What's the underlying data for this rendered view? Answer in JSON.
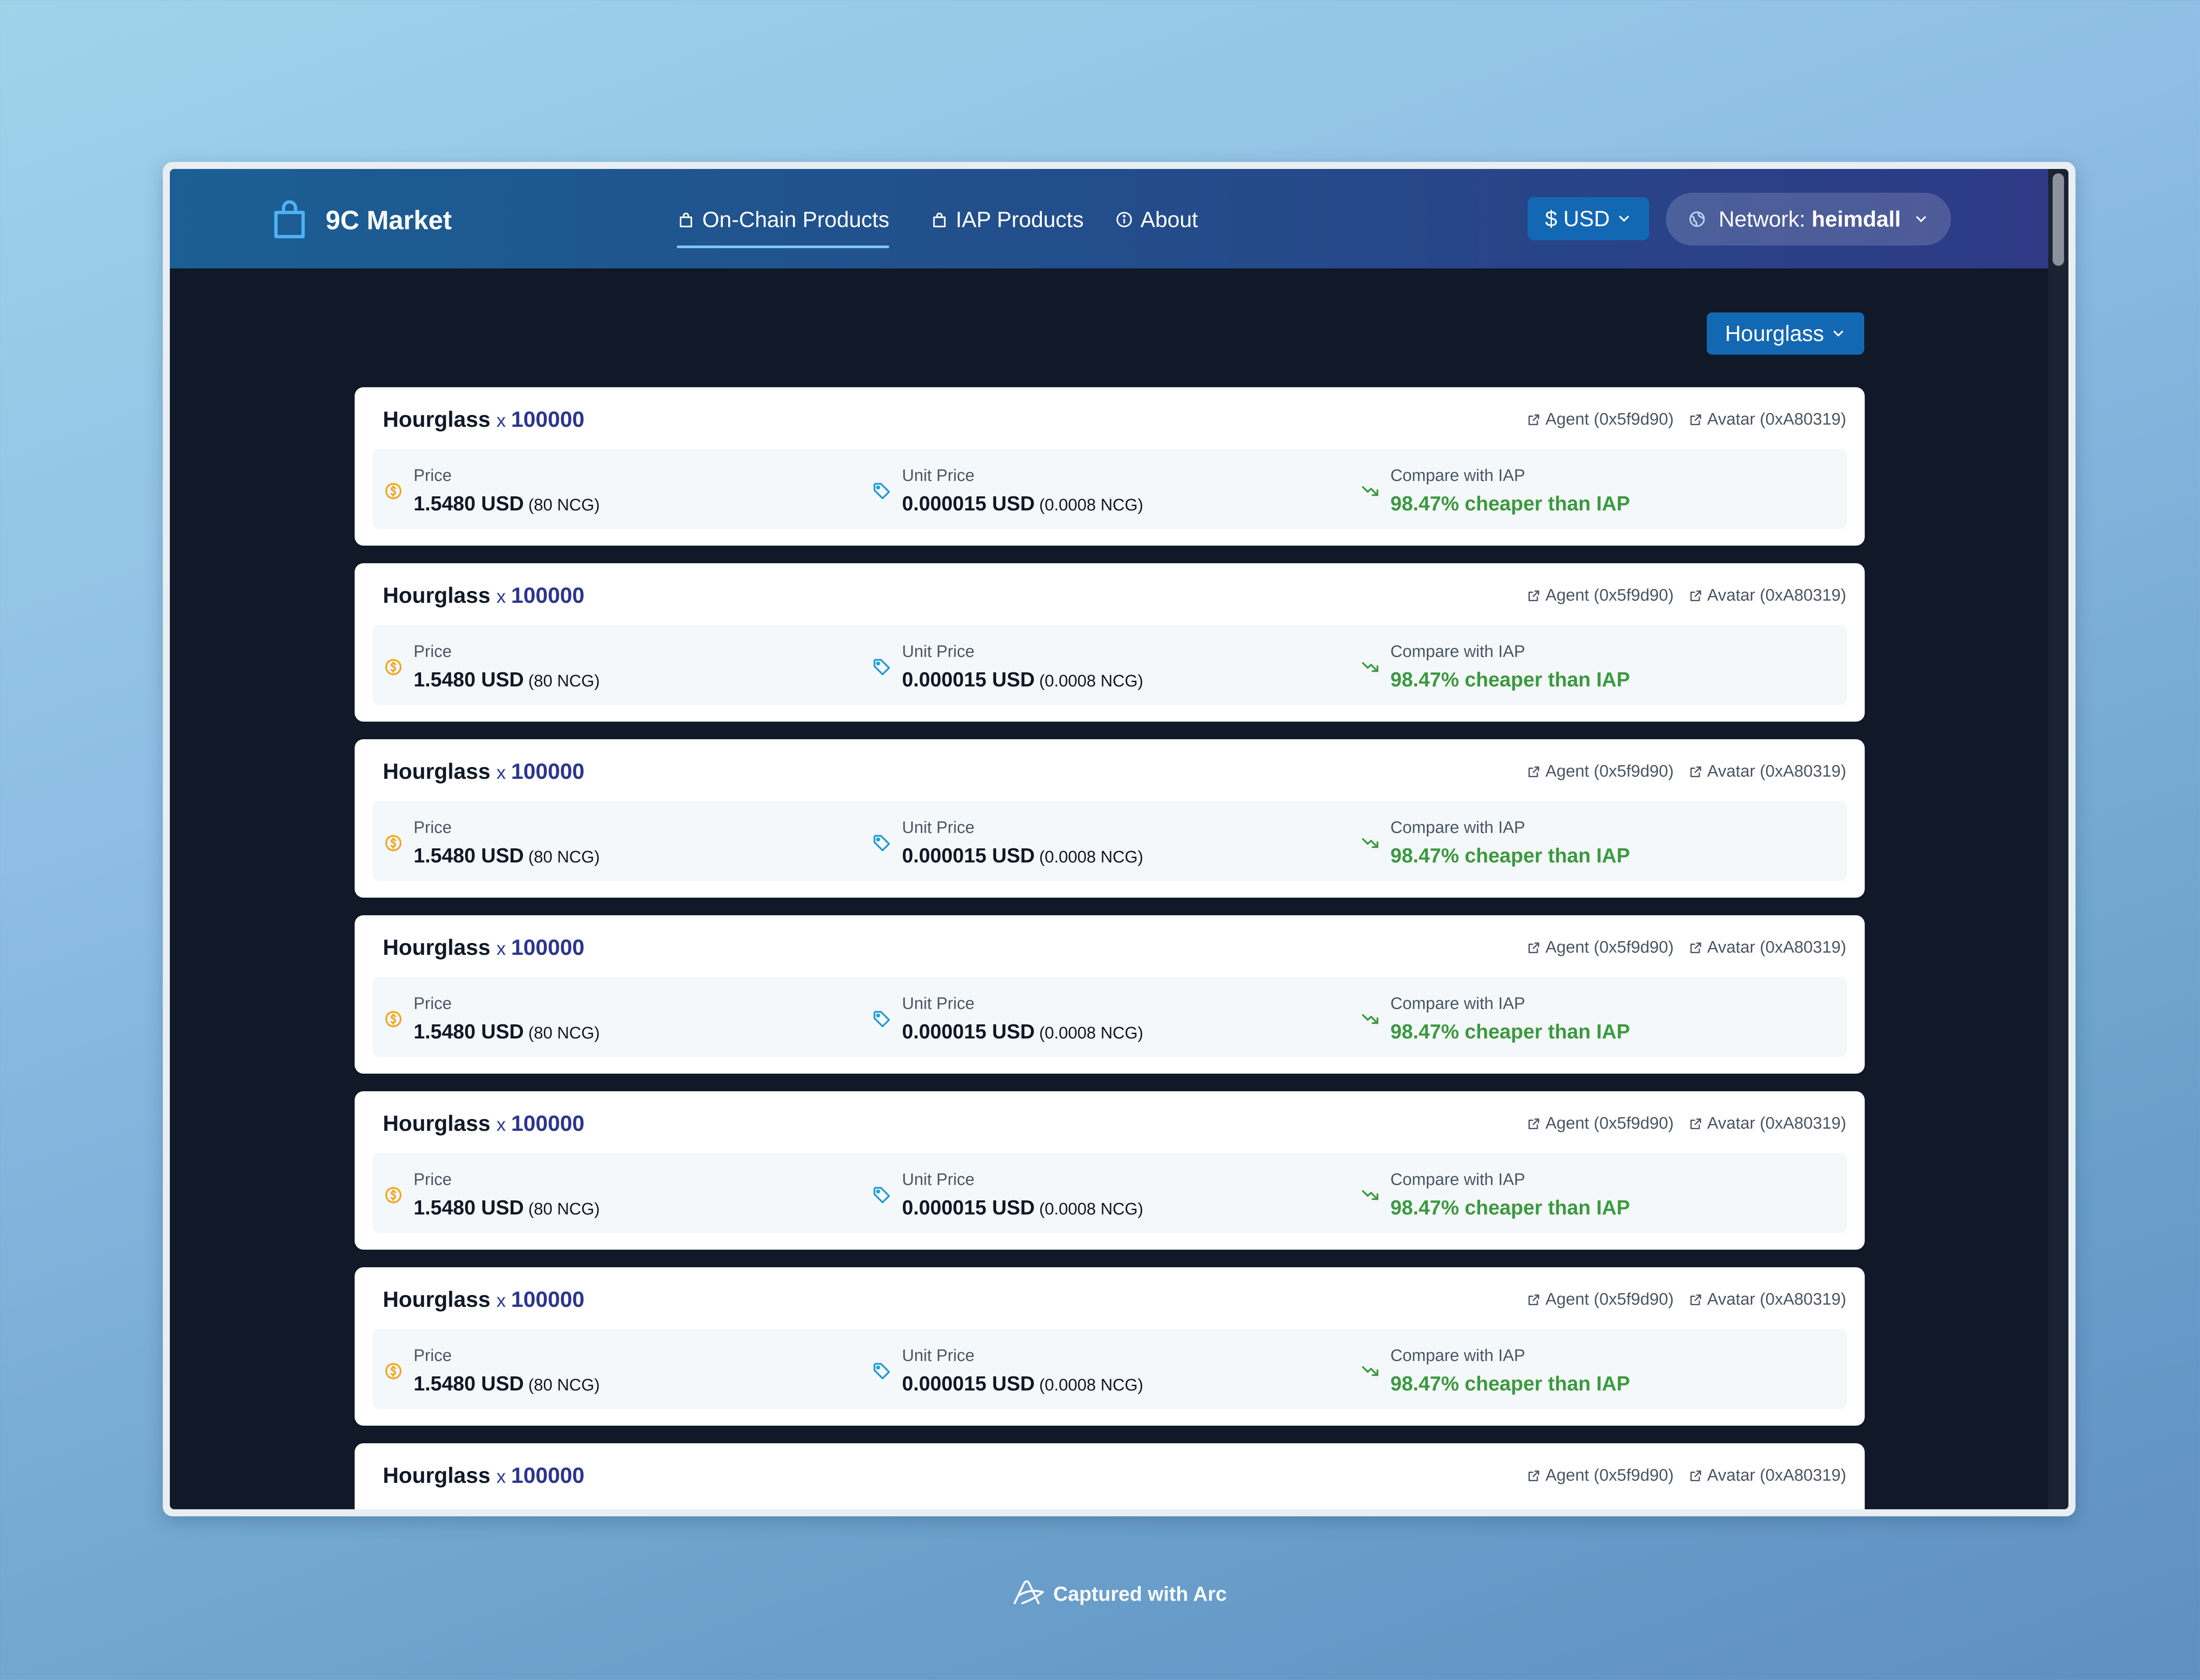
{
  "app": {
    "name": "9C Market"
  },
  "nav": {
    "links": [
      {
        "label": "On-Chain Products",
        "icon": "bag-icon",
        "active": true
      },
      {
        "label": "IAP Products",
        "icon": "bag-icon",
        "active": false
      },
      {
        "label": "About",
        "icon": "info-icon",
        "active": false
      }
    ]
  },
  "currency": {
    "label": "$ USD"
  },
  "network": {
    "prefix": "Network:",
    "value": "heimdall"
  },
  "filter": {
    "selected": "Hourglass"
  },
  "labels": {
    "price": "Price",
    "unit_price": "Unit Price",
    "compare": "Compare with IAP"
  },
  "products": [
    {
      "name": "Hourglass",
      "times": "x",
      "quantity": "100000",
      "agent": "Agent (0x5f9d90)",
      "avatar": "Avatar (0xA80319)",
      "price": "1.5480 USD",
      "price_ncg": "(80 NCG)",
      "unit_price": "0.000015 USD",
      "unit_price_ncg": "(0.0008 NCG)",
      "compare": "98.47% cheaper than IAP"
    },
    {
      "name": "Hourglass",
      "times": "x",
      "quantity": "100000",
      "agent": "Agent (0x5f9d90)",
      "avatar": "Avatar (0xA80319)",
      "price": "1.5480 USD",
      "price_ncg": "(80 NCG)",
      "unit_price": "0.000015 USD",
      "unit_price_ncg": "(0.0008 NCG)",
      "compare": "98.47% cheaper than IAP"
    },
    {
      "name": "Hourglass",
      "times": "x",
      "quantity": "100000",
      "agent": "Agent (0x5f9d90)",
      "avatar": "Avatar (0xA80319)",
      "price": "1.5480 USD",
      "price_ncg": "(80 NCG)",
      "unit_price": "0.000015 USD",
      "unit_price_ncg": "(0.0008 NCG)",
      "compare": "98.47% cheaper than IAP"
    },
    {
      "name": "Hourglass",
      "times": "x",
      "quantity": "100000",
      "agent": "Agent (0x5f9d90)",
      "avatar": "Avatar (0xA80319)",
      "price": "1.5480 USD",
      "price_ncg": "(80 NCG)",
      "unit_price": "0.000015 USD",
      "unit_price_ncg": "(0.0008 NCG)",
      "compare": "98.47% cheaper than IAP"
    },
    {
      "name": "Hourglass",
      "times": "x",
      "quantity": "100000",
      "agent": "Agent (0x5f9d90)",
      "avatar": "Avatar (0xA80319)",
      "price": "1.5480 USD",
      "price_ncg": "(80 NCG)",
      "unit_price": "0.000015 USD",
      "unit_price_ncg": "(0.0008 NCG)",
      "compare": "98.47% cheaper than IAP"
    },
    {
      "name": "Hourglass",
      "times": "x",
      "quantity": "100000",
      "agent": "Agent (0x5f9d90)",
      "avatar": "Avatar (0xA80319)",
      "price": "1.5480 USD",
      "price_ncg": "(80 NCG)",
      "unit_price": "0.000015 USD",
      "unit_price_ncg": "(0.0008 NCG)",
      "compare": "98.47% cheaper than IAP"
    },
    {
      "name": "Hourglass",
      "times": "x",
      "quantity": "100000",
      "agent": "Agent (0x5f9d90)",
      "avatar": "Avatar (0xA80319)"
    }
  ],
  "caption": {
    "text": "Captured with Arc"
  },
  "colors": {
    "navbar_start": "#1b5f94",
    "navbar_end": "#2e3a85",
    "page_background": "#111827",
    "accent_button": "#1368b4",
    "quantity": "#2b3690",
    "savings": "#3a9a3f",
    "price_icon": "#f0a722",
    "unit_price_icon": "#1f9bd8"
  }
}
